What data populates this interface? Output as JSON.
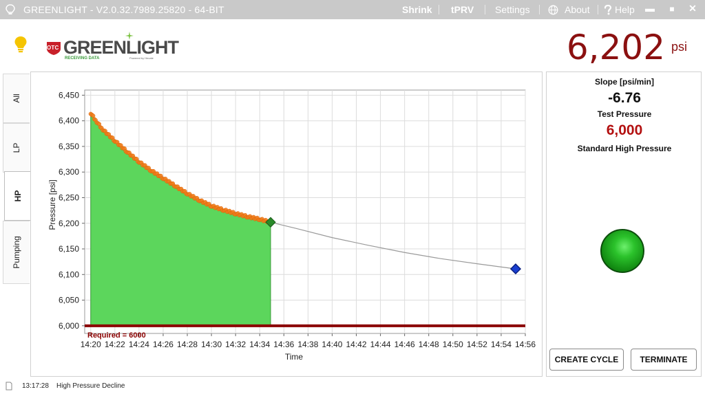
{
  "titlebar": {
    "title": "GREENLIGHT - V2.0.32.7989.25820 - 64-BIT",
    "menu": {
      "shrink": "Shrink",
      "tprv": "tPRV",
      "settings": "Settings",
      "about": "About",
      "help": "Help"
    },
    "icons": {
      "about": "globe-icon",
      "help": "question-icon"
    }
  },
  "header": {
    "logo_text": "GREENLIGHT",
    "logo_subtext": "RECEIVING DATA",
    "logo_badge": "OTC",
    "logo_powered": "Powered by Hecate",
    "pressure_value": "6,202",
    "pressure_unit": "psi",
    "pressure_color": "#8b1010"
  },
  "tabs": [
    {
      "label": "All",
      "active": false
    },
    {
      "label": "LP",
      "active": false
    },
    {
      "label": "HP",
      "active": true
    },
    {
      "label": "Pumping",
      "active": false
    }
  ],
  "info": {
    "slope_label": "Slope [psi/min]",
    "slope_value": "-6.76",
    "test_pressure_label": "Test Pressure",
    "test_pressure_value": "6,000",
    "standard_label": "Standard High Pressure",
    "status_color": "#2bc22b"
  },
  "buttons": {
    "create_cycle": "CREATE CYCLE",
    "terminate": "TERMINATE"
  },
  "statusbar": {
    "time": "13:17:28",
    "message": "High Pressure Decline"
  },
  "chart_data": {
    "type": "line",
    "xlabel": "Time",
    "ylabel": "Pressure [psi]",
    "x_ticks": [
      "14:20",
      "14:22",
      "14:24",
      "14:26",
      "14:28",
      "14:30",
      "14:32",
      "14:34",
      "14:36",
      "14:38",
      "14:40",
      "14:42",
      "14:44",
      "14:46",
      "14:48",
      "14:50",
      "14:52",
      "14:54",
      "14:56"
    ],
    "y_ticks": [
      "6,000",
      "6,050",
      "6,100",
      "6,150",
      "6,200",
      "6,250",
      "6,300",
      "6,350",
      "6,400",
      "6,450"
    ],
    "xlim_minutes_after_1420": [
      -0.5,
      36
    ],
    "ylim": [
      5985,
      6460
    ],
    "grid": true,
    "required_label": "Required = 6000",
    "required_value": 6000,
    "measured_series": {
      "minutes_after_1420": [
        0,
        0.5,
        1,
        2,
        3,
        4,
        5,
        6,
        7,
        8,
        9,
        10,
        11,
        12,
        13,
        14,
        14.9
      ],
      "values": [
        6415,
        6398,
        6383,
        6361,
        6340,
        6320,
        6303,
        6288,
        6273,
        6258,
        6245,
        6234,
        6226,
        6219,
        6213,
        6208,
        6202
      ],
      "color": "#f08020",
      "fill_color": "#5cd65c"
    },
    "projected_series": {
      "minutes_after_1420": [
        14.9,
        17,
        20,
        23,
        26,
        29,
        32,
        35.2
      ],
      "values": [
        6202,
        6190,
        6172,
        6157,
        6143,
        6131,
        6121,
        6111
      ],
      "color": "#999999"
    },
    "current_point": {
      "minutes_after_1420": 14.9,
      "value": 6202,
      "color": "#2a8a2a"
    },
    "end_point": {
      "minutes_after_1420": 35.2,
      "value": 6111,
      "color": "#1a3fd0"
    },
    "required_line_color": "#8b0000"
  }
}
